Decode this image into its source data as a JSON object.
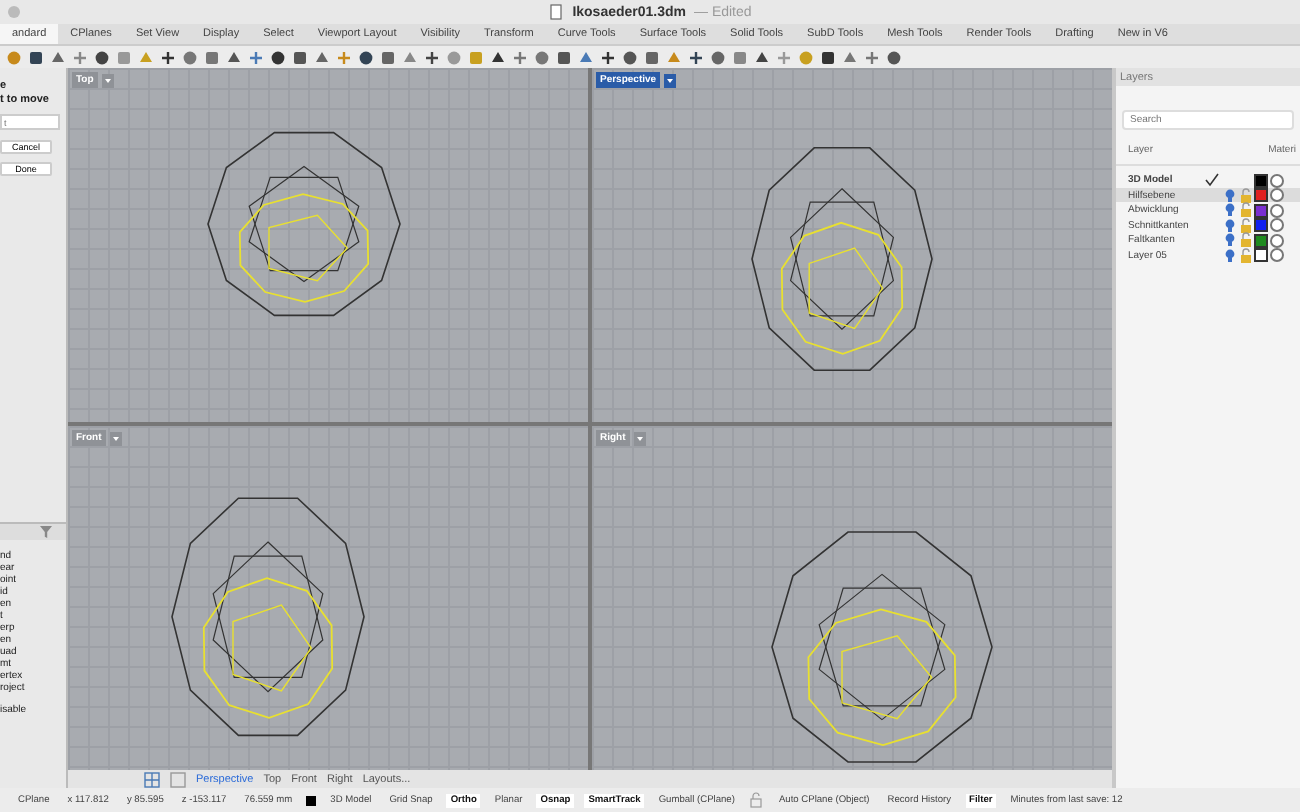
{
  "window": {
    "title": "Ikosaeder01.3dm",
    "status": "— Edited"
  },
  "tabs": [
    {
      "label": "andard",
      "selected": true
    },
    {
      "label": "CPlanes",
      "selected": false
    },
    {
      "label": "Set View",
      "selected": false
    },
    {
      "label": "Display",
      "selected": false
    },
    {
      "label": "Select",
      "selected": false
    },
    {
      "label": "Viewport Layout",
      "selected": false
    },
    {
      "label": "Visibility",
      "selected": false
    },
    {
      "label": "Transform",
      "selected": false
    },
    {
      "label": "Curve Tools",
      "selected": false
    },
    {
      "label": "Surface Tools",
      "selected": false
    },
    {
      "label": "Solid Tools",
      "selected": false
    },
    {
      "label": "SubD Tools",
      "selected": false
    },
    {
      "label": "Mesh Tools",
      "selected": false
    },
    {
      "label": "Render Tools",
      "selected": false
    },
    {
      "label": "Drafting",
      "selected": false
    },
    {
      "label": "New in V6",
      "selected": false
    }
  ],
  "command_panel": {
    "prompt": [
      "e",
      "t to move"
    ],
    "input_placeholder": "t",
    "buttons": [
      "Cancel",
      "Done"
    ]
  },
  "osnap_panel": {
    "items": [
      "nd",
      "ear",
      "oint",
      "id",
      "en",
      "t",
      "erp",
      "en",
      "uad",
      "mt",
      "ertex",
      "roject"
    ],
    "footer": "isable"
  },
  "viewports": [
    {
      "title": "Top",
      "active": false
    },
    {
      "title": "Perspective",
      "active": true
    },
    {
      "title": "Front",
      "active": false
    },
    {
      "title": "Right",
      "active": false
    }
  ],
  "layers": {
    "title": "Layers",
    "search_placeholder": "Search",
    "columns": [
      "Layer",
      "Materi"
    ],
    "rows": [
      {
        "name": "3D Model",
        "current": true,
        "selected": false,
        "color": "#000000"
      },
      {
        "name": "Hilfsebene",
        "current": false,
        "selected": true,
        "color": "#e02020"
      },
      {
        "name": "Abwicklung",
        "current": false,
        "selected": false,
        "color": "#7a2fd0"
      },
      {
        "name": "Schnittkanten",
        "current": false,
        "selected": false,
        "color": "#1020f0"
      },
      {
        "name": "Faltkanten",
        "current": false,
        "selected": false,
        "color": "#1f8a1f"
      },
      {
        "name": "Layer 05",
        "current": false,
        "selected": false,
        "color": "#ffffff"
      }
    ]
  },
  "viewport_tabs": [
    {
      "label": "Perspective",
      "selected": true
    },
    {
      "label": "Top",
      "selected": false
    },
    {
      "label": "Front",
      "selected": false
    },
    {
      "label": "Right",
      "selected": false
    },
    {
      "label": "Layouts...",
      "selected": false
    }
  ],
  "status_bar": [
    {
      "kind": "text",
      "label": "CPlane"
    },
    {
      "kind": "text",
      "label": "x 117.812"
    },
    {
      "kind": "text",
      "label": "y 85.595"
    },
    {
      "kind": "text",
      "label": "z -153.117"
    },
    {
      "kind": "text",
      "label": "76.559 mm"
    },
    {
      "kind": "layer",
      "label": "3D Model",
      "color": "#000000"
    },
    {
      "kind": "toggle",
      "label": "Grid Snap",
      "on": false
    },
    {
      "kind": "toggle",
      "label": "Ortho",
      "on": true
    },
    {
      "kind": "toggle",
      "label": "Planar",
      "on": false
    },
    {
      "kind": "toggle",
      "label": "Osnap",
      "on": true
    },
    {
      "kind": "toggle",
      "label": "SmartTrack",
      "on": true
    },
    {
      "kind": "toggle",
      "label": "Gumball (CPlane)",
      "on": false
    },
    {
      "kind": "lock",
      "label": "Auto CPlane (Object)",
      "on": false
    },
    {
      "kind": "toggle",
      "label": "Record History",
      "on": false
    },
    {
      "kind": "toggle",
      "label": "Filter",
      "on": true
    },
    {
      "kind": "text",
      "label": "Minutes from last save: 12"
    }
  ]
}
